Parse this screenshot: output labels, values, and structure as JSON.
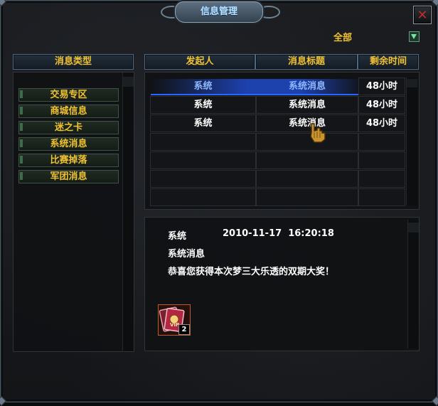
{
  "window": {
    "title": "信息管理",
    "close_icon": "close-icon"
  },
  "filter": {
    "label": "全部"
  },
  "category_panel": {
    "header": "消息类型",
    "items": [
      "交易专区",
      "商城信息",
      "迷之卡",
      "系统消息",
      "比赛掉落",
      "军团消息"
    ]
  },
  "message_table": {
    "columns": [
      "发起人",
      "消息标题",
      "剩余时间"
    ],
    "rows": [
      {
        "sender": "系统",
        "title": "系统消息",
        "remaining": "48小时",
        "selected": true
      },
      {
        "sender": "系统",
        "title": "系统消息",
        "remaining": "48小时",
        "selected": false
      },
      {
        "sender": "系统",
        "title": "系统消息",
        "remaining": "48小时",
        "selected": false
      }
    ]
  },
  "detail": {
    "sender": "系统",
    "datetime": "2010-11-17  16:20:18",
    "subject": "系统消息",
    "body": "恭喜您获得本次梦三大乐透的双期大奖！",
    "attachment": {
      "count": "2",
      "icon": "vip-card-icon"
    }
  },
  "colors": {
    "gold": "#f1c232",
    "text": "#ffffff",
    "selected": "#8fb8ff"
  }
}
